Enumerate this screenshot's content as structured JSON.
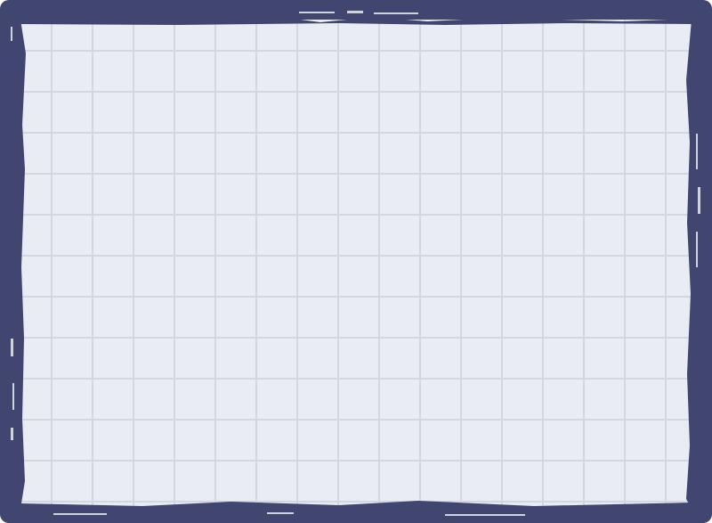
{
  "board": {
    "frame_color": "#404670",
    "paper_color": "#e9ecf4",
    "grid_line_color": "#d3d7e0"
  }
}
